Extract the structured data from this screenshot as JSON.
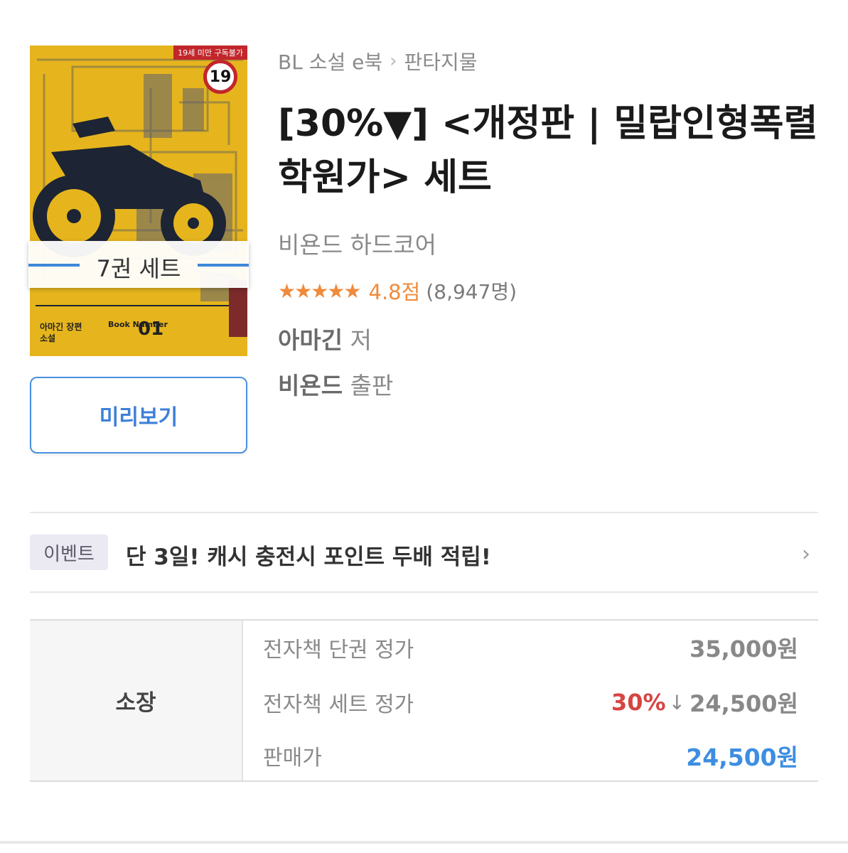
{
  "cover": {
    "badge": "19세 미만 구독불가",
    "age_number": "19",
    "author_label": "아마긴 장편소설",
    "book_label": "Book Number",
    "book_number": "01",
    "set_label": "7권 세트"
  },
  "preview_label": "미리보기",
  "breadcrumb": [
    "BL 소설 e북",
    "판타지물"
  ],
  "title": "[30%▼] <개정판 | 밀랍인형폭렬학원가> 세트",
  "publisher_imprint": "비욘드 하드코어",
  "rating": {
    "stars": 5,
    "score_text": "4.8점",
    "count_text": "(8,947명)"
  },
  "author": {
    "name": "아마긴",
    "suffix": "저"
  },
  "publisher": {
    "name": "비욘드",
    "suffix": "출판"
  },
  "event": {
    "tag": "이벤트",
    "text": "단 3일! 캐시 충전시 포인트 두배 적립!"
  },
  "price": {
    "own_label": "소장",
    "rows": [
      {
        "label": "전자책 단권 정가",
        "value": "35,000원"
      },
      {
        "label": "전자책 세트 정가",
        "discount": "30%",
        "arrow": "↓",
        "value": "24,500원"
      },
      {
        "label": "판매가",
        "value": "24,500원"
      }
    ]
  },
  "colors": {
    "accent_blue": "#3d8ee0",
    "star_orange": "#f08a3c",
    "discount_red": "#d64541",
    "cover_yellow": "#e7b71c"
  }
}
